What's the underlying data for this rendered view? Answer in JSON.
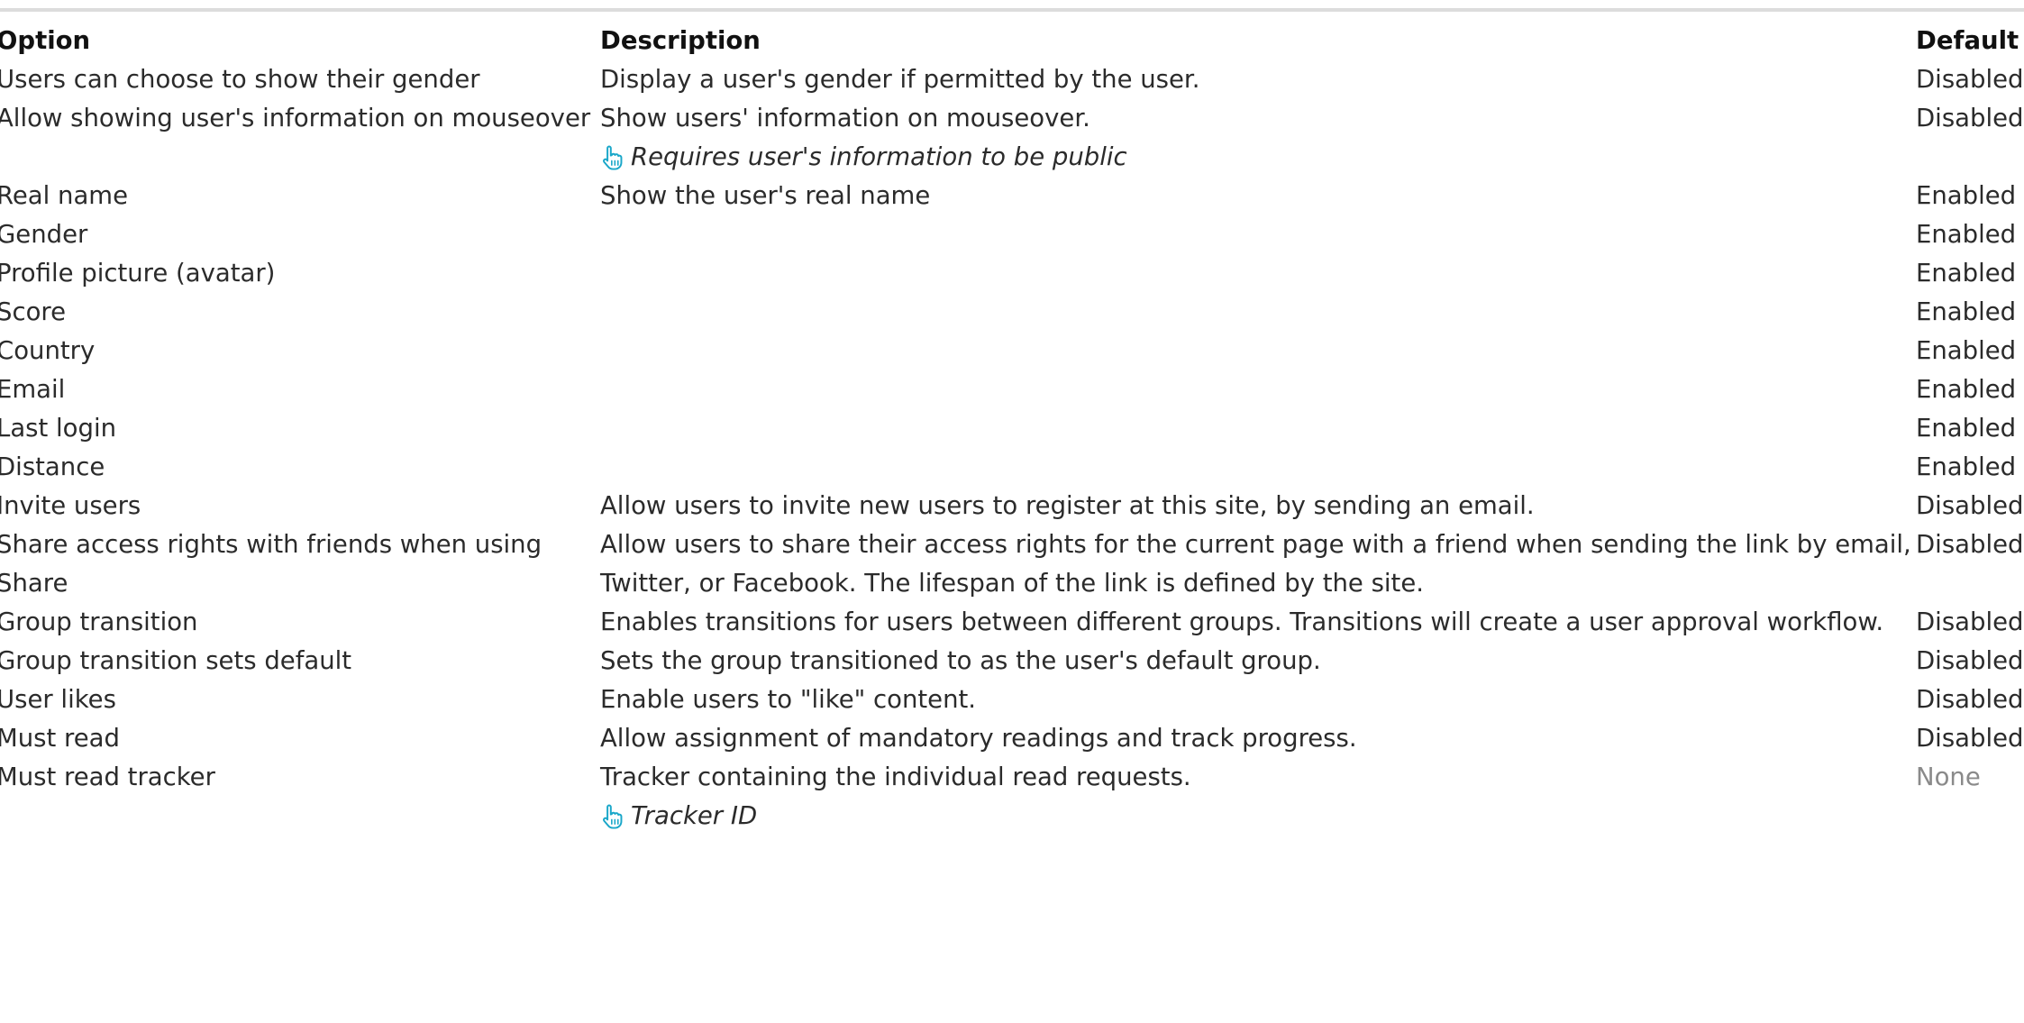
{
  "header": {
    "option": "Option",
    "description": "Description",
    "default": "Default"
  },
  "rows": [
    {
      "option": "Users can choose to show their gender",
      "description": "Display a user's gender if permitted by the user.",
      "default": "Disabled"
    },
    {
      "option": "Allow showing user's information on mouseover",
      "description": "Show users' information on mouseover.",
      "note": "Requires user's information to be public",
      "default": "Disabled"
    },
    {
      "option": "Real name",
      "description": "Show the user's real name",
      "default": "Enabled"
    },
    {
      "option": "Gender",
      "description": "",
      "default": "Enabled"
    },
    {
      "option": "Profile picture (avatar)",
      "description": "",
      "default": "Enabled"
    },
    {
      "option": "Score",
      "description": "",
      "default": "Enabled"
    },
    {
      "option": "Country",
      "description": "",
      "default": "Enabled"
    },
    {
      "option": "Email",
      "description": "",
      "default": "Enabled"
    },
    {
      "option": "Last login",
      "description": "",
      "default": "Enabled"
    },
    {
      "option": "Distance",
      "description": "",
      "default": "Enabled"
    },
    {
      "option": "Invite users",
      "description": "Allow users to invite new users to register at this site, by sending an email.",
      "default": "Disabled"
    },
    {
      "option": "Share access rights with friends when using Share",
      "description": "Allow users to share their access rights for the current page with a friend when sending the link by email, Twitter, or Facebook. The lifespan of the link is defined by the site.",
      "default": "Disabled"
    },
    {
      "option": "Group transition",
      "description": "Enables transitions for users between different groups. Transitions will create a user approval workflow.",
      "default": "Disabled"
    },
    {
      "option": "Group transition sets default",
      "description": "Sets the group transitioned to as the user's default group.",
      "default": "Disabled"
    },
    {
      "option": "User likes",
      "description": "Enable users to \"like\" content.",
      "default": "Disabled"
    },
    {
      "option": "Must read",
      "description": "Allow assignment of mandatory readings and track progress.",
      "default": "Disabled"
    },
    {
      "option": "Must read tracker",
      "description": "Tracker containing the individual read requests.",
      "note": "Tracker ID",
      "default": "None",
      "default_muted": true
    }
  ],
  "icons": {
    "note_icon": "pointing-hand-icon"
  },
  "colors": {
    "icon": "#1aa7c9",
    "muted_text": "#8a8a8a",
    "rule": "#dcdcdc"
  }
}
